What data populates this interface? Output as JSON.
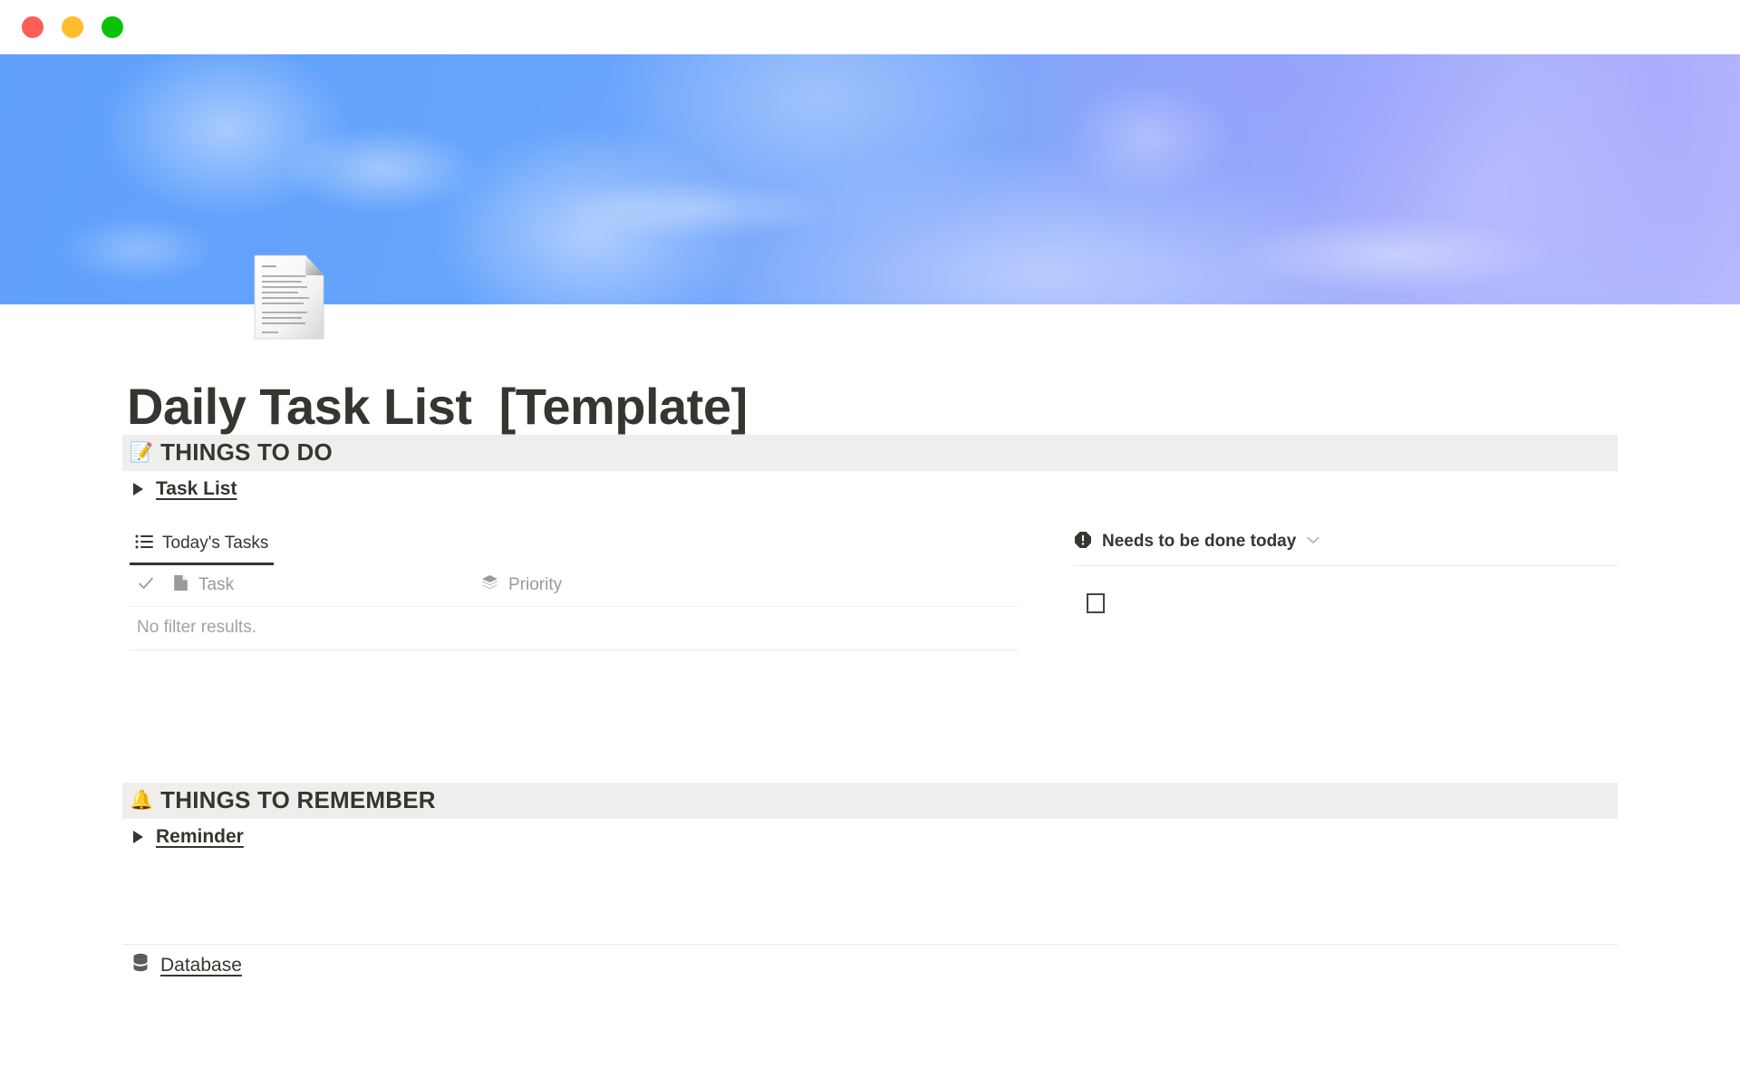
{
  "window": {
    "traffic_lights": [
      {
        "name": "close",
        "color": "#fd5e57"
      },
      {
        "name": "minimize",
        "color": "#ffbd2e"
      },
      {
        "name": "maximize",
        "color": "#0ac20a"
      }
    ]
  },
  "cover": {
    "description": "blue sky with clouds",
    "colors": {
      "left": "#5fa0fc",
      "right": "#b9bdfd"
    }
  },
  "page": {
    "icon": "note-page-icon",
    "title": "Daily Task List  [Template]"
  },
  "sections": [
    {
      "emoji": "📝",
      "emoji_name": "memo-icon",
      "heading": "THINGS TO DO",
      "toggle_label": "Task List"
    },
    {
      "emoji": "🔔",
      "emoji_name": "bell-icon",
      "heading": "THINGS TO REMEMBER",
      "toggle_label": "Reminder"
    }
  ],
  "database": {
    "view_tabs": [
      {
        "label": "Today's Tasks",
        "icon": "list-icon",
        "active": true
      }
    ],
    "columns": [
      {
        "label": "",
        "icon": "checkmark-icon"
      },
      {
        "label": "Task",
        "icon": "page-icon"
      },
      {
        "label": "Priority",
        "icon": "layers-icon"
      }
    ],
    "empty_message": "No filter results."
  },
  "widget": {
    "icon": "alert-octagon-icon",
    "title": "Needs to be done today",
    "chevron": "chevron-down-icon",
    "checkbox_checked": false
  },
  "footer": {
    "link_label": "Database",
    "link_icon": "database-icon"
  },
  "colors": {
    "text": "#37352f",
    "muted": "#9b9a97",
    "band": "#efeeec",
    "rule": "#ecebea"
  }
}
